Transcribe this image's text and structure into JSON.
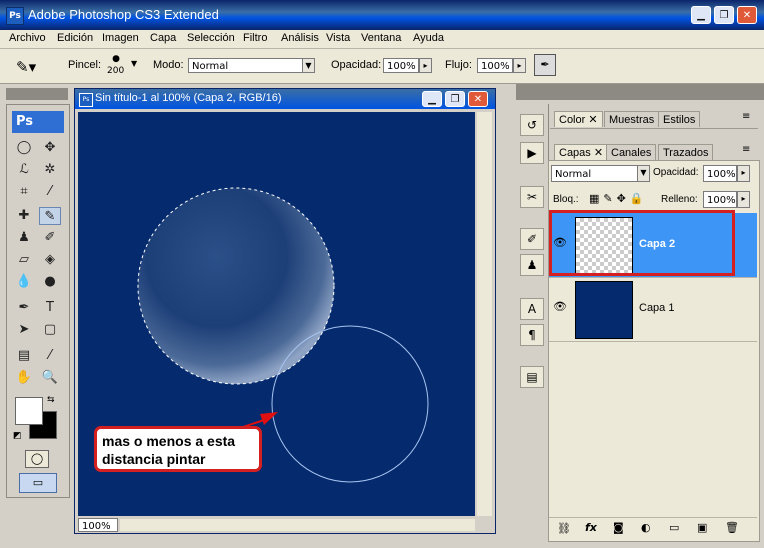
{
  "window": {
    "app_icon": "Ps",
    "title": "Adobe Photoshop CS3 Extended",
    "controls": [
      "minimize-icon",
      "restore-icon",
      "close-icon"
    ]
  },
  "menu": [
    "Archivo",
    "Edición",
    "Imagen",
    "Capa",
    "Selección",
    "Filtro",
    "Análisis",
    "Vista",
    "Ventana",
    "Ayuda"
  ],
  "options": {
    "brush_label": "Pincel:",
    "brush_size": "200",
    "mode_label": "Modo:",
    "mode_value": "Normal",
    "opacity_label": "Opacidad:",
    "opacity_value": "100%",
    "flow_label": "Flujo:",
    "flow_value": "100%"
  },
  "toolbox": {
    "logo": "Ps"
  },
  "document": {
    "title": "Sin título-1 al 100% (Capa 2, RGB/16)",
    "zoom": "100%",
    "annotation": "mas o menos a esta distancia pintar",
    "colors": {
      "canvas": "#052b6e",
      "annotation_border": "#d42020",
      "arrow": "#e01010"
    }
  },
  "panels": {
    "tabs_top": [
      "Color",
      "Muestras",
      "Estilos"
    ],
    "tabs_layers": [
      "Capas",
      "Canales",
      "Trazados"
    ],
    "blend_mode": "Normal",
    "opacity_label": "Opacidad:",
    "opacity_value": "100%",
    "lock_label": "Bloq.:",
    "fill_label": "Relleno:",
    "fill_value": "100%",
    "layers": [
      {
        "name": "Capa 2",
        "selected": true
      },
      {
        "name": "Capa 1",
        "selected": false
      }
    ]
  }
}
